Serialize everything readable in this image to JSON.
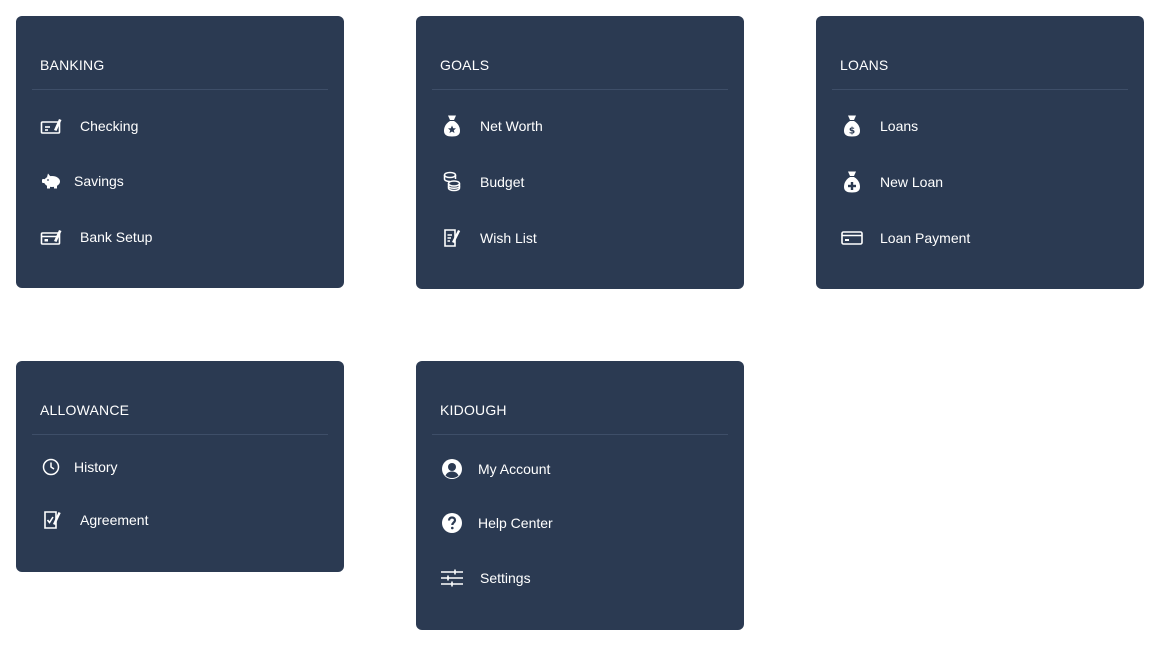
{
  "banking": {
    "title": "BANKING",
    "items": [
      {
        "label": "Checking",
        "icon": "check-icon"
      },
      {
        "label": "Savings",
        "icon": "piggy-bank-icon"
      },
      {
        "label": "Bank Setup",
        "icon": "bank-setup-icon"
      }
    ]
  },
  "goals": {
    "title": "GOALS",
    "items": [
      {
        "label": "Net Worth",
        "icon": "money-bag-star-icon"
      },
      {
        "label": "Budget",
        "icon": "coins-icon"
      },
      {
        "label": "Wish List",
        "icon": "wish-list-icon"
      }
    ]
  },
  "loans": {
    "title": "LOANS",
    "items": [
      {
        "label": "Loans",
        "icon": "money-bag-dollar-icon"
      },
      {
        "label": "New Loan",
        "icon": "money-bag-plus-icon"
      },
      {
        "label": "Loan Payment",
        "icon": "credit-card-icon"
      }
    ]
  },
  "allowance": {
    "title": "ALLOWANCE",
    "items": [
      {
        "label": "History",
        "icon": "clock-icon"
      },
      {
        "label": "Agreement",
        "icon": "agreement-icon"
      }
    ]
  },
  "kidough": {
    "title": "KIDOUGH",
    "items": [
      {
        "label": "My Account",
        "icon": "account-icon"
      },
      {
        "label": "Help Center",
        "icon": "help-icon"
      },
      {
        "label": "Settings",
        "icon": "sliders-icon"
      }
    ]
  },
  "colors": {
    "card_background": "#2b3a52",
    "text": "#ffffff",
    "divider": "#3e4e68"
  }
}
